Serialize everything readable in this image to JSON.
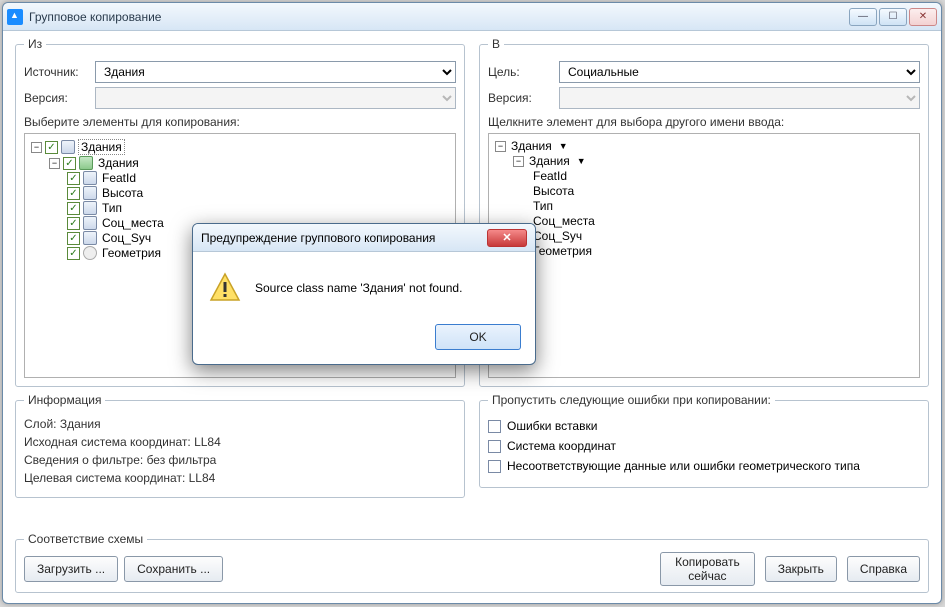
{
  "window": {
    "title": "Групповое копирование"
  },
  "left": {
    "legend": "Из",
    "source_label": "Источник:",
    "source_value": "Здания",
    "version_label": "Версия:",
    "version_value": "",
    "select_label": "Выберите элементы для копирования:",
    "tree": {
      "root": "Здания",
      "child": "Здания",
      "fields": [
        "FeatId",
        "Высота",
        "Тип",
        "Соц_места",
        "Соц_Syч",
        "Геометрия"
      ]
    }
  },
  "right": {
    "legend": "В",
    "target_label": "Цель:",
    "target_value": "Социальные",
    "version_label": "Версия:",
    "version_value": "",
    "select_label": "Щелкните элемент для выбора другого имени ввода:",
    "tree": {
      "root": "Здания",
      "child": "Здания",
      "fields": [
        "FeatId",
        "Высота",
        "Тип",
        "Соц_места",
        "Соц_Syч",
        "Геометрия"
      ]
    }
  },
  "info": {
    "legend": "Информация",
    "layer": "Слой: Здания",
    "src_cs": "Исходная система координат: LL84",
    "filter": "Сведения о фильтре: без фильтра",
    "dst_cs": "Целевая система координат: LL84"
  },
  "errors": {
    "legend": "Пропустить следующие ошибки при копировании:",
    "insert": "Ошибки вставки",
    "cs": "Система координат",
    "geom": "Несоответствующие данные или ошибки геометрического типа"
  },
  "footer": {
    "legend": "Соответствие схемы",
    "load": "Загрузить ...",
    "save": "Сохранить ...",
    "copy": "Копировать\nсейчас",
    "close": "Закрыть",
    "help": "Справка"
  },
  "modal": {
    "title": "Предупреждение группового копирования",
    "message": "Source class name 'Здания' not found.",
    "ok": "OK"
  }
}
